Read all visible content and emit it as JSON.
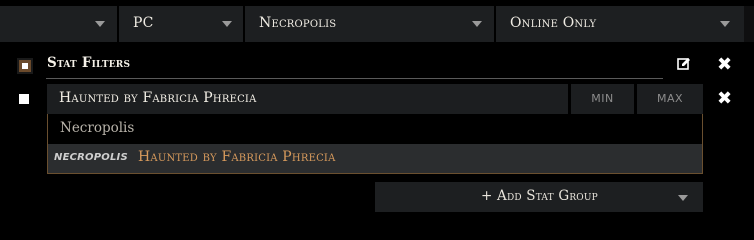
{
  "filters": {
    "first": {
      "label": ""
    },
    "platform": {
      "label": "PC"
    },
    "league": {
      "label": "Necropolis"
    },
    "status": {
      "label": "Online Only"
    }
  },
  "stat_group": {
    "title": "Stat Filters",
    "edit_icon": "edit-icon",
    "remove_icon": "close-icon"
  },
  "stat_row": {
    "value": "Haunted by Fabricia Phrecia",
    "min_placeholder": "MIN",
    "max_placeholder": "MAX",
    "remove_icon": "close-icon"
  },
  "suggestions": {
    "header": "Necropolis",
    "items": [
      {
        "tag": "NECROPOLIS",
        "text": "Haunted by Fabricia Phrecia"
      }
    ]
  },
  "add_group": {
    "label": "+ Add Stat Group"
  },
  "colors": {
    "background": "#000000",
    "control_bg": "#1d1f21",
    "accent_orange": "#d79a5c",
    "border_brown": "#6a4f2f"
  }
}
